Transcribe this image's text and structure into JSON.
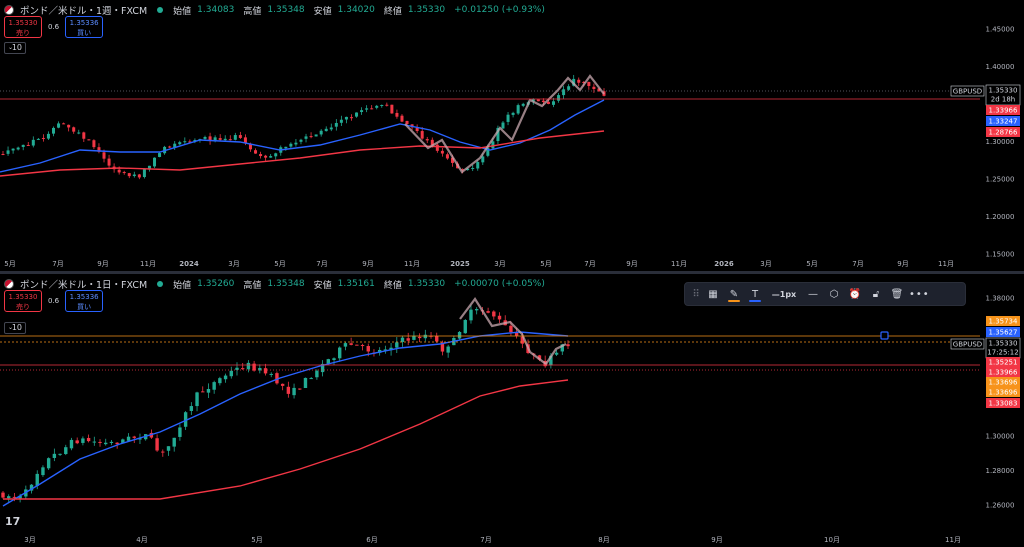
{
  "top_chart": {
    "symbol_title": "ポンド／米ドル・1週・FXCM",
    "ohlc": [
      {
        "label": "始値",
        "value": "1.34083"
      },
      {
        "label": "高値",
        "value": "1.35348"
      },
      {
        "label": "安値",
        "value": "1.34020"
      },
      {
        "label": "終値",
        "value": "1.35330"
      }
    ],
    "change": "+0.01250 (+0.93%)",
    "sell_price": "1.35330",
    "sell_label": "売り",
    "buy_price": "1.35336",
    "buy_label": "買い",
    "spread": "0.6",
    "interval": "10",
    "price_axis": [
      "1.45000",
      "1.40000",
      "1.35000",
      "1.30000",
      "1.25000",
      "1.20000",
      "1.15000",
      "1.10000"
    ],
    "time_axis": [
      "5月",
      "7月",
      "9月",
      "11月",
      "2024",
      "3月",
      "5月",
      "7月",
      "9月",
      "11月",
      "2025",
      "3月",
      "5月",
      "7月",
      "9月",
      "11月",
      "2026",
      "3月",
      "5月",
      "7月",
      "9月",
      "11月"
    ],
    "symbol_tag": "GBPUSD",
    "last_price": "1.35330",
    "countdown": "2d 18h",
    "price_tags": [
      {
        "value": "1.33966",
        "color": "#f23645"
      },
      {
        "value": "1.33247",
        "color": "#2962ff"
      },
      {
        "value": "1.28766",
        "color": "#f23645"
      }
    ]
  },
  "bottom_chart": {
    "symbol_title": "ポンド／米ドル・1日・FXCM",
    "ohlc": [
      {
        "label": "始値",
        "value": "1.35260"
      },
      {
        "label": "高値",
        "value": "1.35348"
      },
      {
        "label": "安値",
        "value": "1.35161"
      },
      {
        "label": "終値",
        "value": "1.35330"
      }
    ],
    "change": "+0.00070 (+0.05%)",
    "sell_price": "1.35330",
    "sell_label": "売り",
    "buy_price": "1.35336",
    "buy_label": "買い",
    "spread": "0.6",
    "interval": "10",
    "price_axis": [
      "1.38000",
      "1.36000",
      "1.34000",
      "1.32000",
      "1.30000",
      "1.28000",
      "1.26000"
    ],
    "time_axis": [
      "3月",
      "4月",
      "5月",
      "6月",
      "7月",
      "8月",
      "9月",
      "10月",
      "11月"
    ],
    "symbol_tag": "GBPUSD",
    "last_price": "1.35330",
    "countdown": "17:25:12",
    "price_tags": [
      {
        "value": "1.35734",
        "color": "#f7931a"
      },
      {
        "value": "1.35627",
        "color": "#2962ff"
      },
      {
        "value": "1.35251",
        "color": "#f23645"
      },
      {
        "value": "1.33966",
        "color": "#f23645"
      },
      {
        "value": "1.33696",
        "color": "#f7931a"
      },
      {
        "value": "1.33696",
        "color": "#f7931a"
      },
      {
        "value": "1.33083",
        "color": "#f23645"
      }
    ]
  },
  "drawing_toolbar": {
    "width_label": "1px",
    "more_label": "•••",
    "pencil_color": "#f7931a",
    "text_color": "#2962ff"
  },
  "logo": "17",
  "colors": {
    "up": "#22ab94",
    "down": "#f23645",
    "ma_fast": "#2962ff",
    "ma_slow": "#f23645"
  }
}
